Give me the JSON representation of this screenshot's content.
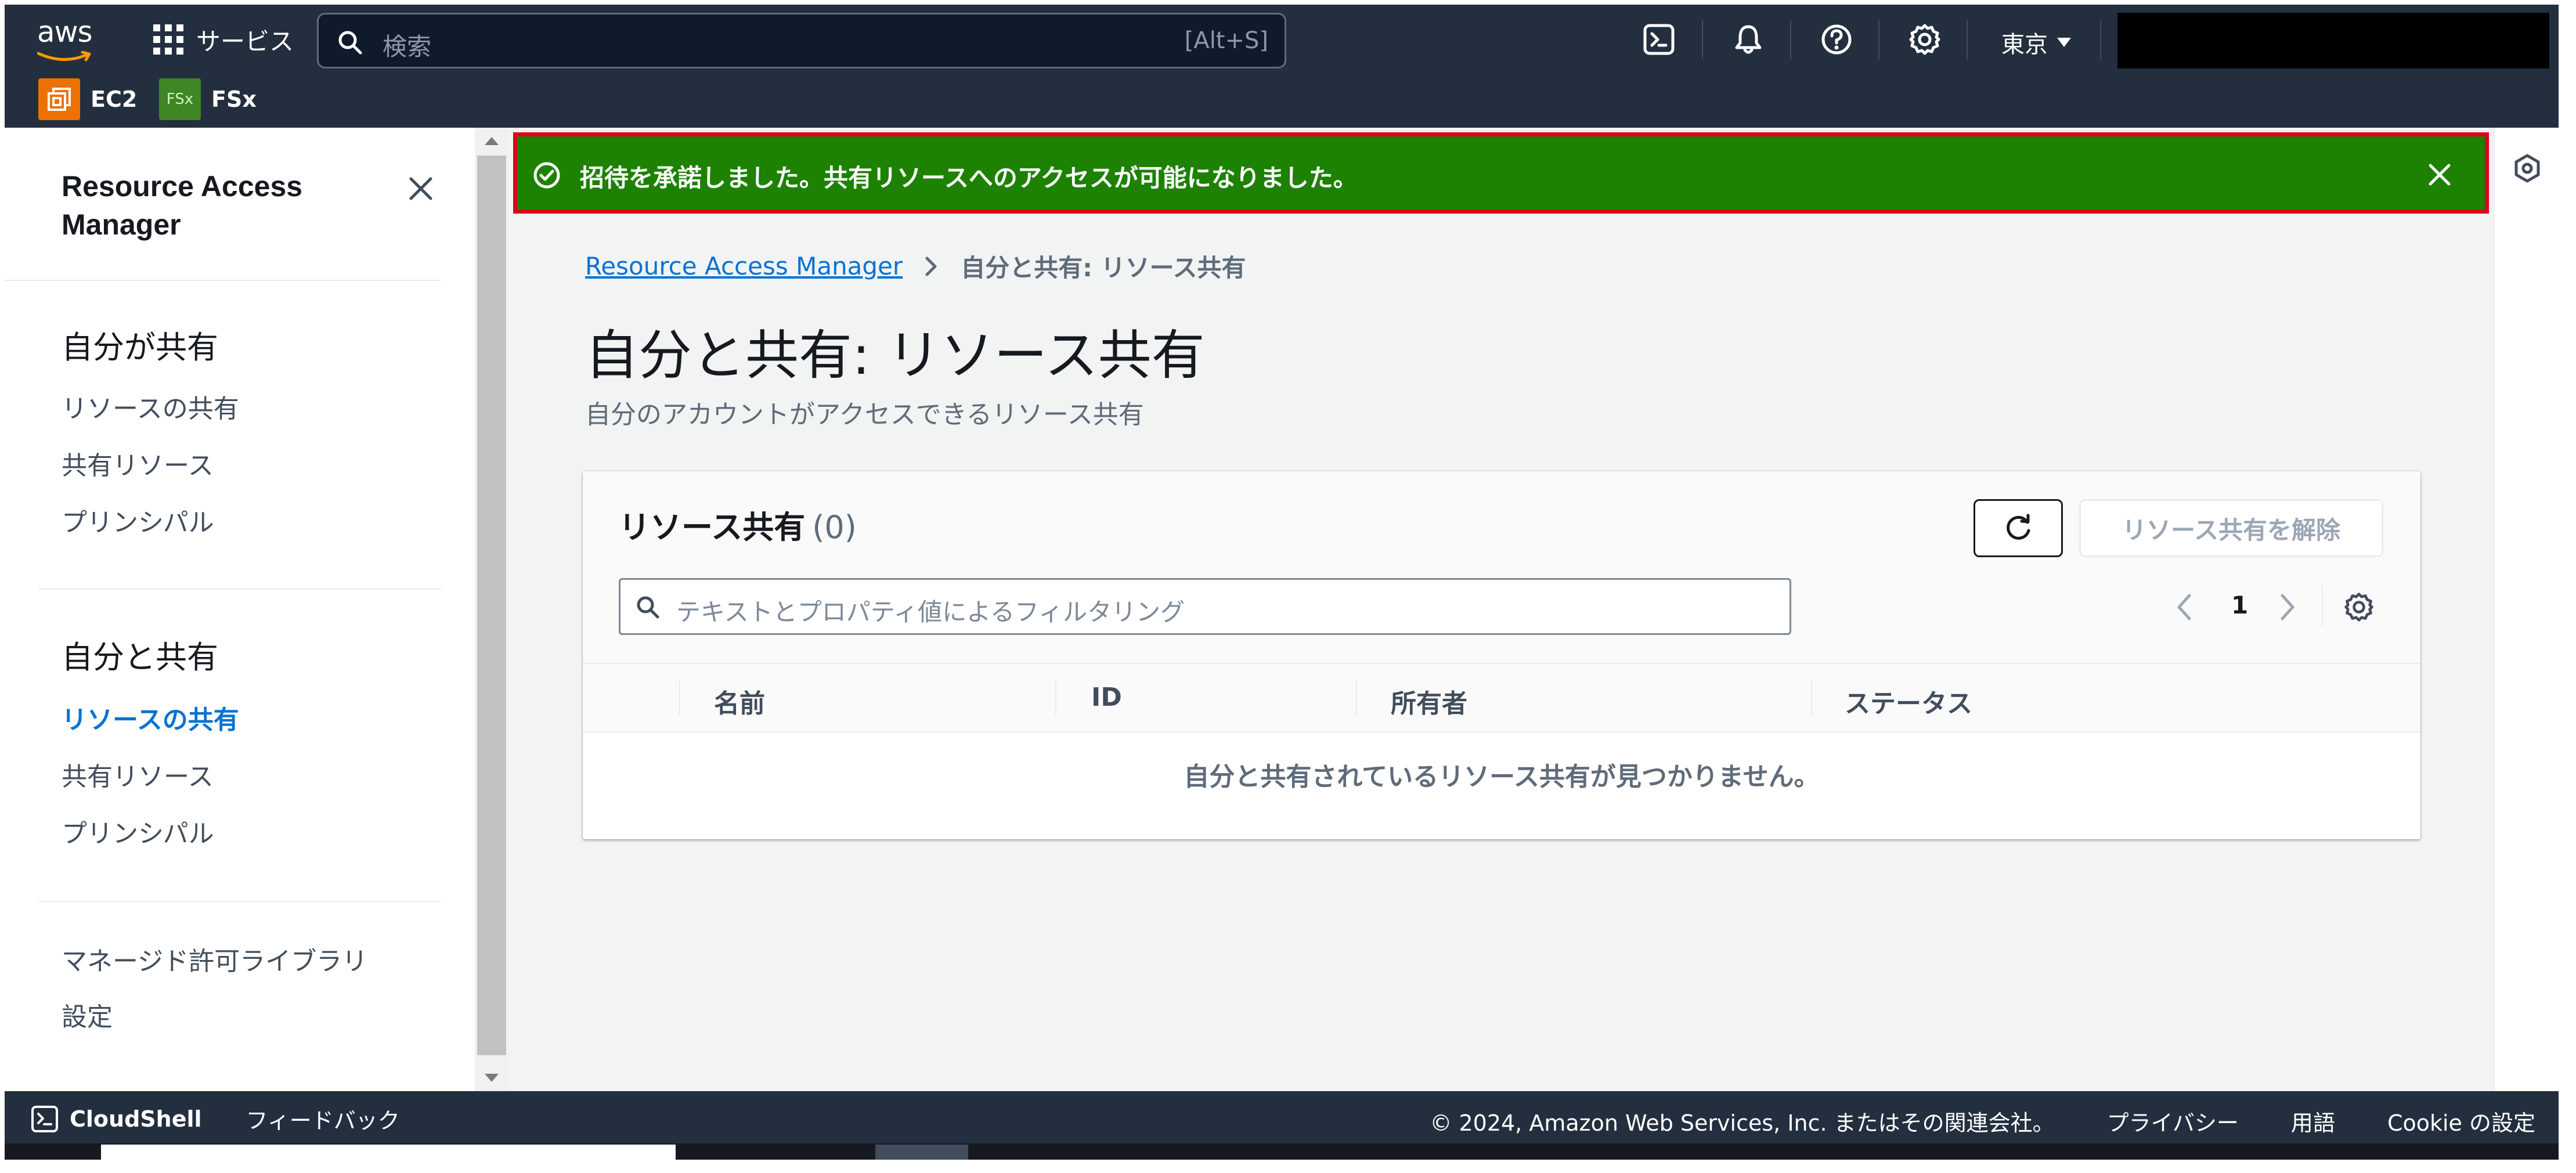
{
  "topbar": {
    "logo_text": "aws",
    "services_label": "サービス",
    "search_placeholder": "検索",
    "search_shortcut": "[Alt+S]",
    "region": "東京",
    "favorites": [
      {
        "label": "EC2",
        "icon": "ec2-icon",
        "color": "#ed7100"
      },
      {
        "label": "FSx",
        "badge": "FSx",
        "icon": "fsx-icon",
        "color": "#3f8624"
      }
    ]
  },
  "sidenav": {
    "title": "Resource Access Manager",
    "section1": {
      "heading": "自分が共有",
      "items": [
        "リソースの共有",
        "共有リソース",
        "プリンシパル"
      ]
    },
    "section2": {
      "heading": "自分と共有",
      "items": [
        "リソースの共有",
        "共有リソース",
        "プリンシパル"
      ],
      "active": "リソースの共有"
    },
    "section3": {
      "items": [
        "マネージド許可ライブラリ",
        "設定"
      ]
    }
  },
  "flash": {
    "type": "success",
    "message": "招待を承諾しました。共有リソースへのアクセスが可能になりました。",
    "color": "#1d8102",
    "highlight": "#e0001b"
  },
  "breadcrumb": {
    "root": "Resource Access Manager",
    "current": "自分と共有: リソース共有"
  },
  "page": {
    "title": "自分と共有: リソース共有",
    "description": "自分のアカウントがアクセスできるリソース共有"
  },
  "table": {
    "title": "リソース共有",
    "count": "(0)",
    "delete_button": "リソース共有を解除",
    "filter_placeholder": "テキストとプロパティ値によるフィルタリング",
    "page": "1",
    "columns": [
      "名前",
      "ID",
      "所有者",
      "ステータス"
    ],
    "empty_message": "自分と共有されているリソース共有が見つかりません。"
  },
  "footer": {
    "cloudshell": "CloudShell",
    "feedback": "フィードバック",
    "copyright": "© 2024, Amazon Web Services, Inc. またはその関連会社。",
    "privacy": "プライバシー",
    "terms": "用語",
    "cookie": "Cookie の設定"
  }
}
